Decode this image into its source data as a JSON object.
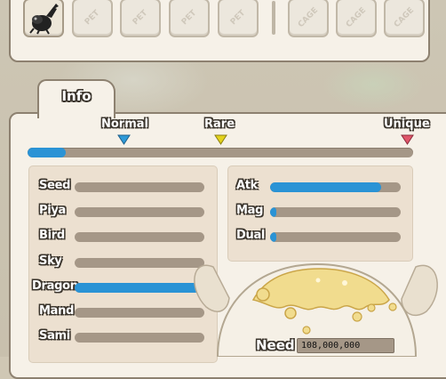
{
  "colors": {
    "accent_bar": "#2a93d5",
    "track": "#a59787",
    "panel": "#f6f1e8",
    "border": "#8d8170"
  },
  "toolbar": {
    "slots": [
      {
        "icon": "beetle-icon",
        "selected": true
      },
      {
        "icon": "pet-slot-icon",
        "glyph": "PET"
      },
      {
        "icon": "pet-slot-icon",
        "glyph": "PET"
      },
      {
        "icon": "pet-slot-icon",
        "glyph": "PET"
      },
      {
        "icon": "pet-slot-icon",
        "glyph": "PET"
      },
      {
        "icon": "cage-slot-icon",
        "glyph": "CAGE"
      },
      {
        "icon": "cage-slot-icon",
        "glyph": "CAGE"
      },
      {
        "icon": "cage-slot-icon",
        "glyph": "CAGE"
      }
    ]
  },
  "tab": {
    "label": "Info"
  },
  "rarity": {
    "labels": [
      "Normal",
      "Rare",
      "Unique"
    ],
    "marker_colors": [
      "#2f9ad8",
      "#e0d020",
      "#e05060"
    ],
    "progress": 0.1
  },
  "types": [
    {
      "label": "Seed",
      "value": 0
    },
    {
      "label": "Piya",
      "value": 0
    },
    {
      "label": "Bird",
      "value": 0
    },
    {
      "label": "Sky",
      "value": 0
    },
    {
      "label": "Dragon",
      "value": 1.0
    },
    {
      "label": "Mand",
      "value": 0
    },
    {
      "label": "Sami",
      "value": 0
    }
  ],
  "attacks": [
    {
      "label": "Atk",
      "value": 0.85
    },
    {
      "label": "Mag",
      "value": 0.05
    },
    {
      "label": "Dual",
      "value": 0.05
    }
  ],
  "need": {
    "label": "Need",
    "value": "108,000,000"
  }
}
